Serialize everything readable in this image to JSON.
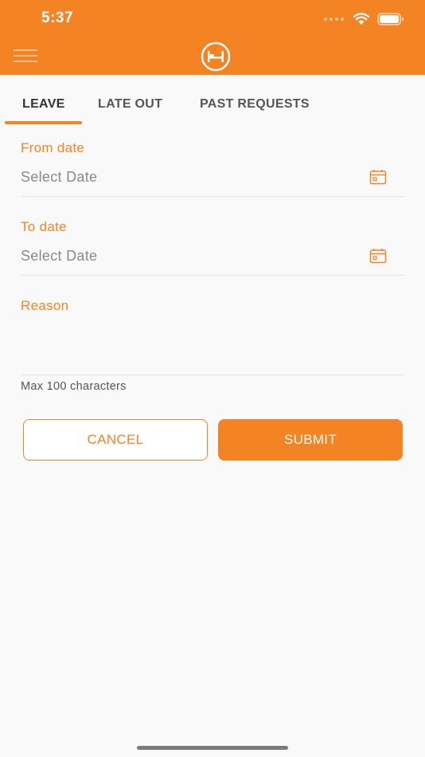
{
  "status_bar": {
    "time": "5:37"
  },
  "tabs": [
    {
      "label": "LEAVE",
      "active": true
    },
    {
      "label": "LATE OUT",
      "active": false
    },
    {
      "label": "PAST REQUESTS",
      "active": false
    }
  ],
  "form": {
    "from_date": {
      "label": "From date",
      "placeholder": "Select Date"
    },
    "to_date": {
      "label": "To date",
      "placeholder": "Select Date"
    },
    "reason": {
      "label": "Reason",
      "value": "",
      "hint": "Max 100 characters"
    }
  },
  "buttons": {
    "cancel_label": "CANCEL",
    "submit_label": "SUBMIT"
  },
  "icons": [
    "hamburger-menu-icon",
    "bed-logo-icon",
    "calendar-icon",
    "wifi-icon",
    "battery-icon"
  ],
  "colors": {
    "accent": "#f48324",
    "background": "#f9f9f9",
    "placeholder": "#8a8a8a"
  }
}
